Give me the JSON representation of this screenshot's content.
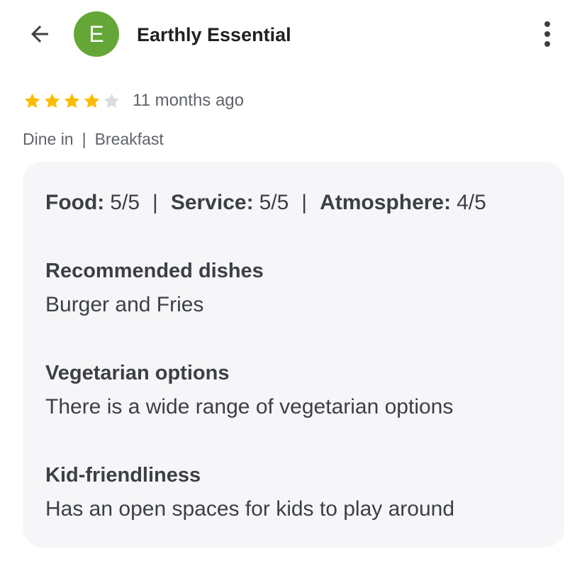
{
  "header": {
    "avatar_letter": "E",
    "author_name": "Earthly Essential",
    "back_icon": "arrow-left-icon",
    "more_icon": "more-vert-icon"
  },
  "rating": {
    "stars": 4,
    "max_stars": 5,
    "time_ago": "11 months ago"
  },
  "meta": {
    "service_type": "Dine in",
    "separator": "|",
    "meal_type": "Breakfast"
  },
  "scores": {
    "food_label": "Food:",
    "food_value": "5/5",
    "service_label": "Service:",
    "service_value": "5/5",
    "atmosphere_label": "Atmosphere:",
    "atmosphere_value": "4/5",
    "separator": "|"
  },
  "sections": [
    {
      "heading": "Recommended dishes",
      "text": "Burger and Fries"
    },
    {
      "heading": "Vegetarian options",
      "text": "There is a wide range of vegetarian options"
    },
    {
      "heading": "Kid-friendliness",
      "text": "Has an open spaces for kids to play around"
    }
  ],
  "colors": {
    "avatar_bg": "#65a737",
    "star_filled": "#fbbc04",
    "star_empty": "#dadce0",
    "card_bg": "#f6f6f8"
  }
}
